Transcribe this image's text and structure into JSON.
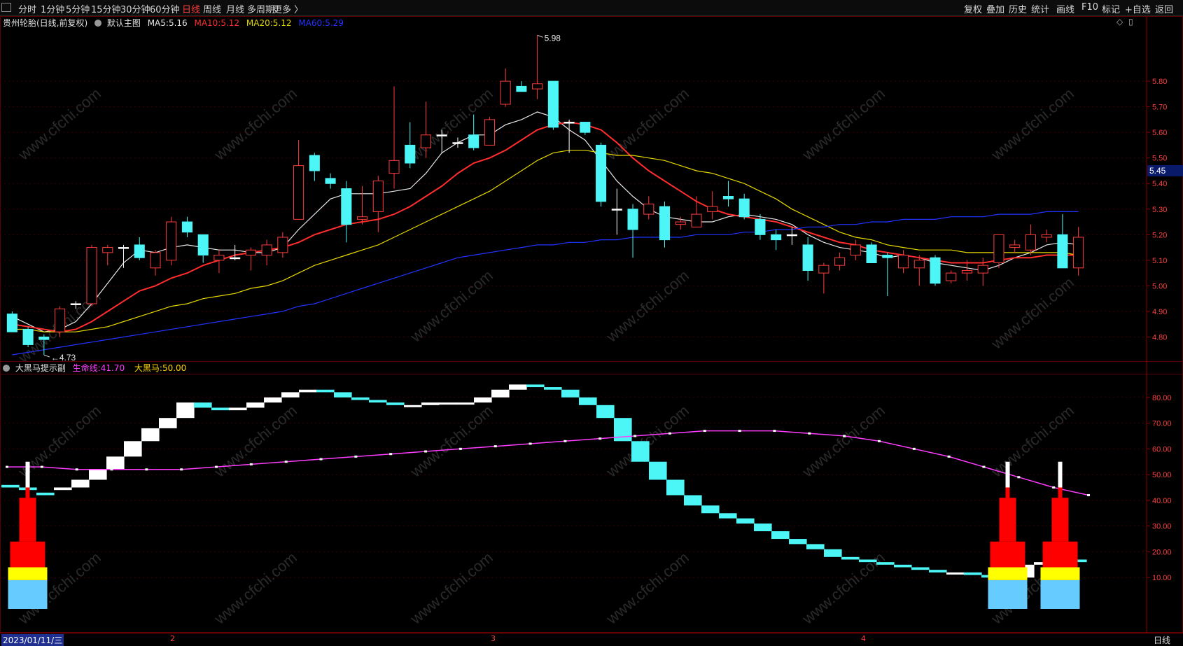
{
  "toolbar": {
    "left_items": [
      "分时",
      "1分钟",
      "5分钟",
      "15分钟",
      "30分钟",
      "60分钟",
      "日线",
      "周线",
      "月线",
      "多周期",
      "更多 〉"
    ],
    "active_index": 6,
    "right_items": [
      "复权",
      "叠加",
      "历史",
      "统计",
      "画线",
      "F10",
      "标记",
      "+自选",
      "返回"
    ]
  },
  "main_panel": {
    "stock_title": "贵州轮胎(日线,前复权)",
    "template_name": "默认主图",
    "ma5": {
      "label": "MA5:",
      "value": "5.16",
      "color": "#e8e8e8"
    },
    "ma10": {
      "label": "MA10:",
      "value": "5.12",
      "color": "#ff2d2d"
    },
    "ma20": {
      "label": "MA20:",
      "value": "5.12",
      "color": "#e5d800"
    },
    "ma60": {
      "label": "MA60:",
      "value": "5.29",
      "color": "#2233ff"
    },
    "high_label": "5.98",
    "low_label": "4.73",
    "current_price": "5.45",
    "watermark": "www.cfchi.com"
  },
  "sub_panel": {
    "indicator_name": "大黑马提示副",
    "line1": {
      "label": "生命线:",
      "value": "41.70",
      "color": "#ff3cff"
    },
    "line2": {
      "label": "大黑马:",
      "value": "50.00",
      "color": "#ffd700"
    }
  },
  "bottom": {
    "date_label": "2023/01/11/三",
    "month_marks": [
      "2",
      "3",
      "4"
    ],
    "period_label": "日线"
  },
  "colors": {
    "up": "#ff3c3c",
    "down": "#4cf6f6",
    "neutral": "#ffffff",
    "grid": "#5a0000",
    "axis_text": "#ff4040"
  },
  "chart_data": [
    {
      "type": "candlestick",
      "title": "贵州轮胎(日线,前复权)",
      "y_ticks": [
        "5.80",
        "5.70",
        "5.60",
        "5.50",
        "5.40",
        "5.30",
        "5.20",
        "5.10",
        "5.00",
        "4.90",
        "4.80"
      ],
      "ylim": [
        4.7,
        6.0
      ],
      "candles": [
        {
          "o": 4.89,
          "h": 4.9,
          "l": 4.82,
          "c": 4.82
        },
        {
          "o": 4.83,
          "h": 4.84,
          "l": 4.76,
          "c": 4.77
        },
        {
          "o": 4.8,
          "h": 4.81,
          "l": 4.73,
          "c": 4.79
        },
        {
          "o": 4.82,
          "h": 4.92,
          "l": 4.8,
          "c": 4.91
        },
        {
          "o": 4.93,
          "h": 4.94,
          "l": 4.91,
          "c": 4.93
        },
        {
          "o": 4.93,
          "h": 5.16,
          "l": 4.92,
          "c": 5.15
        },
        {
          "o": 5.13,
          "h": 5.16,
          "l": 5.08,
          "c": 5.15
        },
        {
          "o": 5.15,
          "h": 5.16,
          "l": 5.07,
          "c": 5.15
        },
        {
          "o": 5.16,
          "h": 5.19,
          "l": 5.1,
          "c": 5.11
        },
        {
          "o": 5.07,
          "h": 5.14,
          "l": 5.04,
          "c": 5.13
        },
        {
          "o": 5.1,
          "h": 5.27,
          "l": 5.08,
          "c": 5.25
        },
        {
          "o": 5.25,
          "h": 5.27,
          "l": 5.19,
          "c": 5.21
        },
        {
          "o": 5.2,
          "h": 5.2,
          "l": 5.09,
          "c": 5.12
        },
        {
          "o": 5.1,
          "h": 5.14,
          "l": 5.05,
          "c": 5.12
        },
        {
          "o": 5.11,
          "h": 5.16,
          "l": 5.1,
          "c": 5.11
        },
        {
          "o": 5.12,
          "h": 5.15,
          "l": 5.06,
          "c": 5.14
        },
        {
          "o": 5.12,
          "h": 5.18,
          "l": 5.08,
          "c": 5.16
        },
        {
          "o": 5.13,
          "h": 5.21,
          "l": 5.11,
          "c": 5.19
        },
        {
          "o": 5.26,
          "h": 5.57,
          "l": 5.26,
          "c": 5.47
        },
        {
          "o": 5.51,
          "h": 5.52,
          "l": 5.41,
          "c": 5.45
        },
        {
          "o": 5.42,
          "h": 5.44,
          "l": 5.38,
          "c": 5.4
        },
        {
          "o": 5.38,
          "h": 5.41,
          "l": 5.17,
          "c": 5.24
        },
        {
          "o": 5.26,
          "h": 5.39,
          "l": 5.24,
          "c": 5.27
        },
        {
          "o": 5.29,
          "h": 5.43,
          "l": 5.21,
          "c": 5.41
        },
        {
          "o": 5.44,
          "h": 5.78,
          "l": 5.38,
          "c": 5.49
        },
        {
          "o": 5.55,
          "h": 5.64,
          "l": 5.46,
          "c": 5.48
        },
        {
          "o": 5.54,
          "h": 5.72,
          "l": 5.5,
          "c": 5.59
        },
        {
          "o": 5.59,
          "h": 5.61,
          "l": 5.52,
          "c": 5.59
        },
        {
          "o": 5.56,
          "h": 5.58,
          "l": 5.54,
          "c": 5.56
        },
        {
          "o": 5.59,
          "h": 5.67,
          "l": 5.53,
          "c": 5.54
        },
        {
          "o": 5.55,
          "h": 5.66,
          "l": 5.55,
          "c": 5.65
        },
        {
          "o": 5.71,
          "h": 5.85,
          "l": 5.7,
          "c": 5.8
        },
        {
          "o": 5.78,
          "h": 5.8,
          "l": 5.77,
          "c": 5.76
        },
        {
          "o": 5.77,
          "h": 5.98,
          "l": 5.73,
          "c": 5.79
        },
        {
          "o": 5.8,
          "h": 5.8,
          "l": 5.61,
          "c": 5.62
        },
        {
          "o": 5.64,
          "h": 5.65,
          "l": 5.52,
          "c": 5.64
        },
        {
          "o": 5.64,
          "h": 5.61,
          "l": 5.59,
          "c": 5.6
        },
        {
          "o": 5.55,
          "h": 5.56,
          "l": 5.31,
          "c": 5.33
        },
        {
          "o": 5.3,
          "h": 5.38,
          "l": 5.2,
          "c": 5.3
        },
        {
          "o": 5.3,
          "h": 5.32,
          "l": 5.11,
          "c": 5.22
        },
        {
          "o": 5.28,
          "h": 5.35,
          "l": 5.26,
          "c": 5.32
        },
        {
          "o": 5.31,
          "h": 5.33,
          "l": 5.15,
          "c": 5.18
        },
        {
          "o": 5.24,
          "h": 5.27,
          "l": 5.22,
          "c": 5.25
        },
        {
          "o": 5.23,
          "h": 5.35,
          "l": 5.23,
          "c": 5.28
        },
        {
          "o": 5.29,
          "h": 5.37,
          "l": 5.26,
          "c": 5.31
        },
        {
          "o": 5.35,
          "h": 5.41,
          "l": 5.31,
          "c": 5.34
        },
        {
          "o": 5.34,
          "h": 5.36,
          "l": 5.26,
          "c": 5.27
        },
        {
          "o": 5.26,
          "h": 5.28,
          "l": 5.18,
          "c": 5.2
        },
        {
          "o": 5.2,
          "h": 5.22,
          "l": 5.14,
          "c": 5.18
        },
        {
          "o": 5.2,
          "h": 5.23,
          "l": 5.16,
          "c": 5.2
        },
        {
          "o": 5.16,
          "h": 5.19,
          "l": 5.02,
          "c": 5.06
        },
        {
          "o": 5.05,
          "h": 5.09,
          "l": 4.97,
          "c": 5.08
        },
        {
          "o": 5.08,
          "h": 5.13,
          "l": 5.06,
          "c": 5.11
        },
        {
          "o": 5.12,
          "h": 5.18,
          "l": 5.1,
          "c": 5.16
        },
        {
          "o": 5.16,
          "h": 5.17,
          "l": 5.09,
          "c": 5.09
        },
        {
          "o": 5.12,
          "h": 5.13,
          "l": 4.96,
          "c": 5.11
        },
        {
          "o": 5.07,
          "h": 5.14,
          "l": 5.05,
          "c": 5.12
        },
        {
          "o": 5.07,
          "h": 5.12,
          "l": 5.0,
          "c": 5.1
        },
        {
          "o": 5.11,
          "h": 5.12,
          "l": 5.0,
          "c": 5.01
        },
        {
          "o": 5.02,
          "h": 5.06,
          "l": 5.01,
          "c": 5.05
        },
        {
          "o": 5.05,
          "h": 5.1,
          "l": 5.02,
          "c": 5.06
        },
        {
          "o": 5.05,
          "h": 5.11,
          "l": 5.0,
          "c": 5.08
        },
        {
          "o": 5.09,
          "h": 5.2,
          "l": 5.07,
          "c": 5.2
        },
        {
          "o": 5.15,
          "h": 5.18,
          "l": 5.13,
          "c": 5.16
        },
        {
          "o": 5.14,
          "h": 5.24,
          "l": 5.12,
          "c": 5.2
        },
        {
          "o": 5.19,
          "h": 5.22,
          "l": 5.17,
          "c": 5.2
        },
        {
          "o": 5.2,
          "h": 5.28,
          "l": 5.07,
          "c": 5.07
        },
        {
          "o": 5.07,
          "h": 5.23,
          "l": 5.04,
          "c": 5.19
        }
      ],
      "series": [
        {
          "name": "MA5",
          "values": [
            4.88,
            4.85,
            4.82,
            4.83,
            4.86,
            4.93,
            5.01,
            5.09,
            5.14,
            5.13,
            5.15,
            5.16,
            5.15,
            5.14,
            5.14,
            5.13,
            5.13,
            5.15,
            5.22,
            5.28,
            5.34,
            5.36,
            5.36,
            5.36,
            5.37,
            5.38,
            5.44,
            5.52,
            5.56,
            5.59,
            5.59,
            5.63,
            5.65,
            5.68,
            5.66,
            5.61,
            5.57,
            5.49,
            5.41,
            5.35,
            5.3,
            5.27,
            5.26,
            5.25,
            5.25,
            5.27,
            5.28,
            5.27,
            5.26,
            5.24,
            5.2,
            5.17,
            5.15,
            5.14,
            5.13,
            5.11,
            5.12,
            5.11,
            5.09,
            5.08,
            5.07,
            5.06,
            5.08,
            5.11,
            5.13,
            5.16,
            5.17,
            5.16
          ]
        },
        {
          "name": "MA10",
          "values": [
            4.85,
            4.84,
            4.83,
            4.82,
            4.83,
            4.86,
            4.9,
            4.94,
            4.98,
            5.0,
            5.03,
            5.05,
            5.08,
            5.1,
            5.12,
            5.13,
            5.14,
            5.15,
            5.17,
            5.2,
            5.22,
            5.24,
            5.25,
            5.26,
            5.28,
            5.31,
            5.35,
            5.39,
            5.44,
            5.48,
            5.5,
            5.53,
            5.57,
            5.61,
            5.63,
            5.64,
            5.63,
            5.61,
            5.56,
            5.5,
            5.45,
            5.41,
            5.37,
            5.33,
            5.3,
            5.28,
            5.27,
            5.26,
            5.25,
            5.23,
            5.21,
            5.19,
            5.17,
            5.16,
            5.14,
            5.13,
            5.12,
            5.11,
            5.1,
            5.09,
            5.09,
            5.09,
            5.1,
            5.11,
            5.11,
            5.12,
            5.12,
            5.12
          ]
        },
        {
          "name": "MA20",
          "values": [
            4.83,
            4.83,
            4.82,
            4.82,
            4.82,
            4.83,
            4.84,
            4.86,
            4.88,
            4.9,
            4.92,
            4.93,
            4.95,
            4.96,
            4.97,
            4.99,
            5.0,
            5.02,
            5.05,
            5.08,
            5.1,
            5.12,
            5.14,
            5.16,
            5.19,
            5.22,
            5.25,
            5.28,
            5.31,
            5.34,
            5.37,
            5.41,
            5.45,
            5.49,
            5.52,
            5.53,
            5.53,
            5.52,
            5.51,
            5.51,
            5.5,
            5.49,
            5.47,
            5.45,
            5.44,
            5.42,
            5.4,
            5.37,
            5.34,
            5.3,
            5.27,
            5.24,
            5.21,
            5.19,
            5.18,
            5.16,
            5.15,
            5.14,
            5.14,
            5.14,
            5.13,
            5.13,
            5.13,
            5.13,
            5.13,
            5.13,
            5.13,
            5.12
          ]
        },
        {
          "name": "MA60",
          "values": [
            4.73,
            4.74,
            4.75,
            4.76,
            4.77,
            4.78,
            4.79,
            4.8,
            4.81,
            4.82,
            4.83,
            4.84,
            4.85,
            4.86,
            4.87,
            4.88,
            4.89,
            4.9,
            4.92,
            4.93,
            4.95,
            4.97,
            4.99,
            5.01,
            5.03,
            5.05,
            5.07,
            5.09,
            5.11,
            5.12,
            5.13,
            5.14,
            5.15,
            5.16,
            5.16,
            5.17,
            5.17,
            5.18,
            5.18,
            5.19,
            5.19,
            5.19,
            5.19,
            5.2,
            5.2,
            5.2,
            5.21,
            5.21,
            5.22,
            5.22,
            5.23,
            5.23,
            5.24,
            5.24,
            5.25,
            5.25,
            5.26,
            5.26,
            5.26,
            5.27,
            5.27,
            5.27,
            5.28,
            5.28,
            5.28,
            5.29,
            5.29,
            5.29
          ]
        }
      ]
    },
    {
      "type": "bar",
      "title": "大黑马提示副",
      "y_ticks": [
        "80.00",
        "70.00",
        "60.00",
        "50.00",
        "40.00",
        "30.00",
        "20.00",
        "10.00"
      ],
      "ylim": [
        0,
        90
      ],
      "ribbon_open": [
        46,
        45,
        43,
        44,
        45,
        48,
        52,
        57,
        63,
        68,
        72,
        78,
        76,
        75,
        76,
        78,
        80,
        82,
        83,
        82,
        80,
        79,
        78,
        77,
        77,
        78,
        78,
        78,
        80,
        83,
        85,
        84,
        83,
        80,
        77,
        72,
        63,
        55,
        48,
        42,
        38,
        35,
        33,
        31,
        28,
        25,
        23,
        21,
        18,
        17,
        16,
        15,
        14,
        13,
        12,
        12,
        11,
        10,
        10,
        15,
        16,
        17
      ],
      "ribbon_close": [
        45,
        44,
        42,
        45,
        48,
        52,
        57,
        63,
        68,
        72,
        78,
        76,
        75,
        76,
        78,
        80,
        82,
        83,
        82,
        80,
        79,
        78,
        77,
        77,
        78,
        78,
        78,
        80,
        83,
        85,
        84,
        83,
        80,
        77,
        72,
        63,
        55,
        48,
        42,
        38,
        35,
        33,
        31,
        28,
        25,
        23,
        21,
        18,
        17,
        16,
        15,
        14,
        13,
        12,
        12,
        11,
        10,
        10,
        15,
        16,
        17,
        16
      ],
      "lifeline": [
        53,
        53,
        52,
        52,
        52,
        52,
        53,
        54,
        55,
        56,
        57,
        58,
        59,
        60,
        61,
        62,
        63,
        64,
        65,
        66,
        67,
        67,
        67,
        66,
        65,
        63,
        60,
        57,
        53,
        49,
        45,
        42
      ],
      "signals": [
        {
          "index": 1,
          "value": 50
        },
        {
          "index": 57,
          "value": 50
        },
        {
          "index": 60,
          "value": 50
        }
      ]
    }
  ]
}
